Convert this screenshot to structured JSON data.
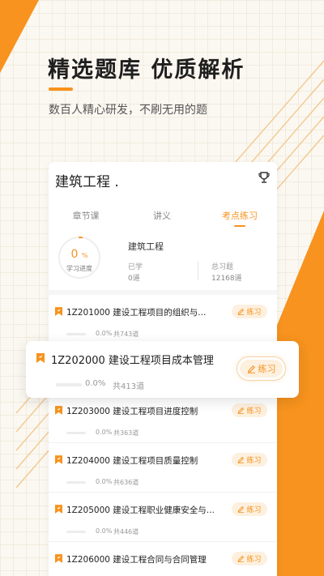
{
  "promo": {
    "headline": "精选题库  优质解析",
    "subline": "数百人精心研发，不刷无用的题"
  },
  "card": {
    "title": "建筑工程 .",
    "tabs": [
      {
        "label": "章节课",
        "active": false
      },
      {
        "label": "讲义",
        "active": false
      },
      {
        "label": "考点练习",
        "active": true
      }
    ],
    "progress": {
      "value": "0",
      "unit": "%",
      "label": "学习进度",
      "fraction": 0.02
    },
    "subject_name": "建筑工程",
    "stats": {
      "learned_label": "已学",
      "learned_value": "0道",
      "total_label": "总习题",
      "total_value": "12168道"
    },
    "practice_label": "练习",
    "chapters": [
      {
        "title": "1Z201000  建设工程项目的组织与...",
        "pct": "0.0%",
        "total": "共743道"
      },
      {
        "title": "1Z202000  建设工程项目成本管理",
        "pct": "0.0%",
        "total": "共413道"
      },
      {
        "title": "1Z203000  建设工程项目进度控制",
        "pct": "0.0%",
        "total": "共363道"
      },
      {
        "title": "1Z204000  建设工程项目质量控制",
        "pct": "0.0%",
        "total": "共636道"
      },
      {
        "title": "1Z205000  建设工程职业健康安全与...",
        "pct": "0.0%",
        "total": "共446道"
      },
      {
        "title": "1Z206000  建设工程合同与合同管理",
        "pct": "",
        "total": ""
      }
    ]
  },
  "popup": {
    "title": "1Z202000  建设工程项目成本管理",
    "pct": "0.0%",
    "total": "共413道",
    "practice_label": "练习"
  },
  "colors": {
    "accent": "#f7931e",
    "accent_soft": "#fdf0df"
  },
  "icons": [
    "trophy-icon",
    "bookmark-icon",
    "pencil-icon"
  ]
}
